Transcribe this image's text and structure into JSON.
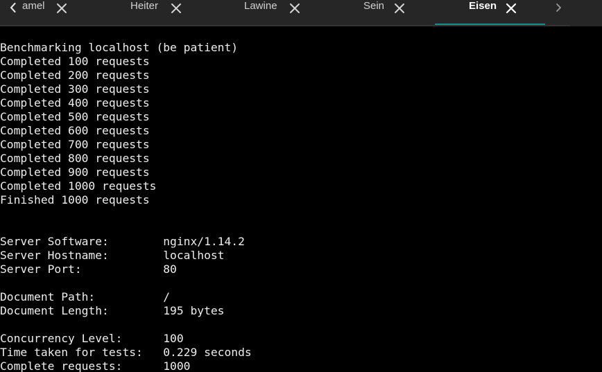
{
  "tabs": [
    {
      "label": "amel",
      "active": false
    },
    {
      "label": "Heiter",
      "active": false
    },
    {
      "label": "Lawine",
      "active": false
    },
    {
      "label": "Sein",
      "active": false
    },
    {
      "label": "Eisen",
      "active": true
    }
  ],
  "icons": {
    "scroll_left": "chevron-left-icon",
    "scroll_right": "chevron-right-icon",
    "close": "close-icon"
  },
  "colors": {
    "tab_bar": "#262626",
    "active_underline": "#1a8c8c",
    "terminal_bg": "#000000",
    "terminal_fg": "#ededed"
  },
  "terminal": {
    "lines": [
      "Benchmarking localhost (be patient)",
      "Completed 100 requests",
      "Completed 200 requests",
      "Completed 300 requests",
      "Completed 400 requests",
      "Completed 500 requests",
      "Completed 600 requests",
      "Completed 700 requests",
      "Completed 800 requests",
      "Completed 900 requests",
      "Completed 1000 requests",
      "Finished 1000 requests",
      "",
      "",
      "Server Software:        nginx/1.14.2",
      "Server Hostname:        localhost",
      "Server Port:            80",
      "",
      "Document Path:          /",
      "Document Length:        195 bytes",
      "",
      "Concurrency Level:      100",
      "Time taken for tests:   0.229 seconds",
      "Complete requests:      1000"
    ]
  }
}
